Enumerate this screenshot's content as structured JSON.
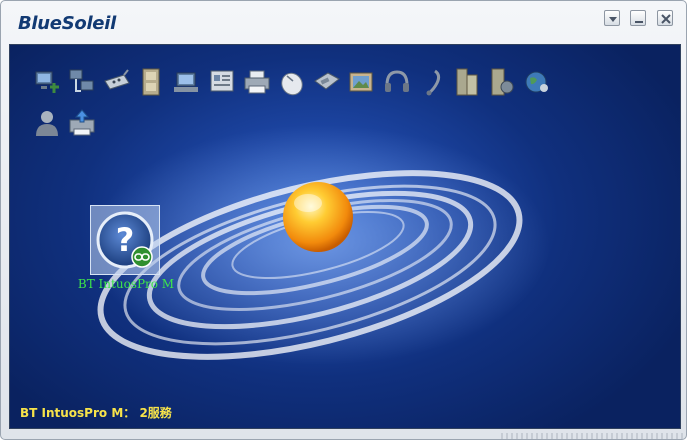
{
  "window": {
    "app_name": "BlueSoleil",
    "controls": {
      "menu": "menu-arrow-icon",
      "minimize": "minimize-icon",
      "close": "close-icon"
    }
  },
  "services": [
    {
      "name": "network-icon"
    },
    {
      "name": "lan-access-icon"
    },
    {
      "name": "serial-port-icon"
    },
    {
      "name": "file-transfer-icon"
    },
    {
      "name": "dial-up-networking-icon"
    },
    {
      "name": "pim-sync-icon"
    },
    {
      "name": "printer-icon"
    },
    {
      "name": "mouse-hid-icon"
    },
    {
      "name": "fax-icon"
    },
    {
      "name": "image-transfer-icon"
    },
    {
      "name": "headphones-icon"
    },
    {
      "name": "headset-icon"
    },
    {
      "name": "object-push-icon"
    },
    {
      "name": "object-exchange-icon"
    },
    {
      "name": "globe-network-icon"
    },
    {
      "name": "personal-area-icon"
    },
    {
      "name": "basic-imaging-icon"
    }
  ],
  "device": {
    "label": "BT IntuosPro M",
    "icon": "unknown-device-question-icon",
    "badge": "paired-link-icon"
  },
  "status": {
    "text": "BT IntuosPro M： 2服務"
  },
  "colors": {
    "background": "#10307e",
    "device_label": "#3ee64a",
    "status_text": "#f7e34a",
    "logo": "#123a73",
    "logo_arc": "#f3a21a"
  }
}
